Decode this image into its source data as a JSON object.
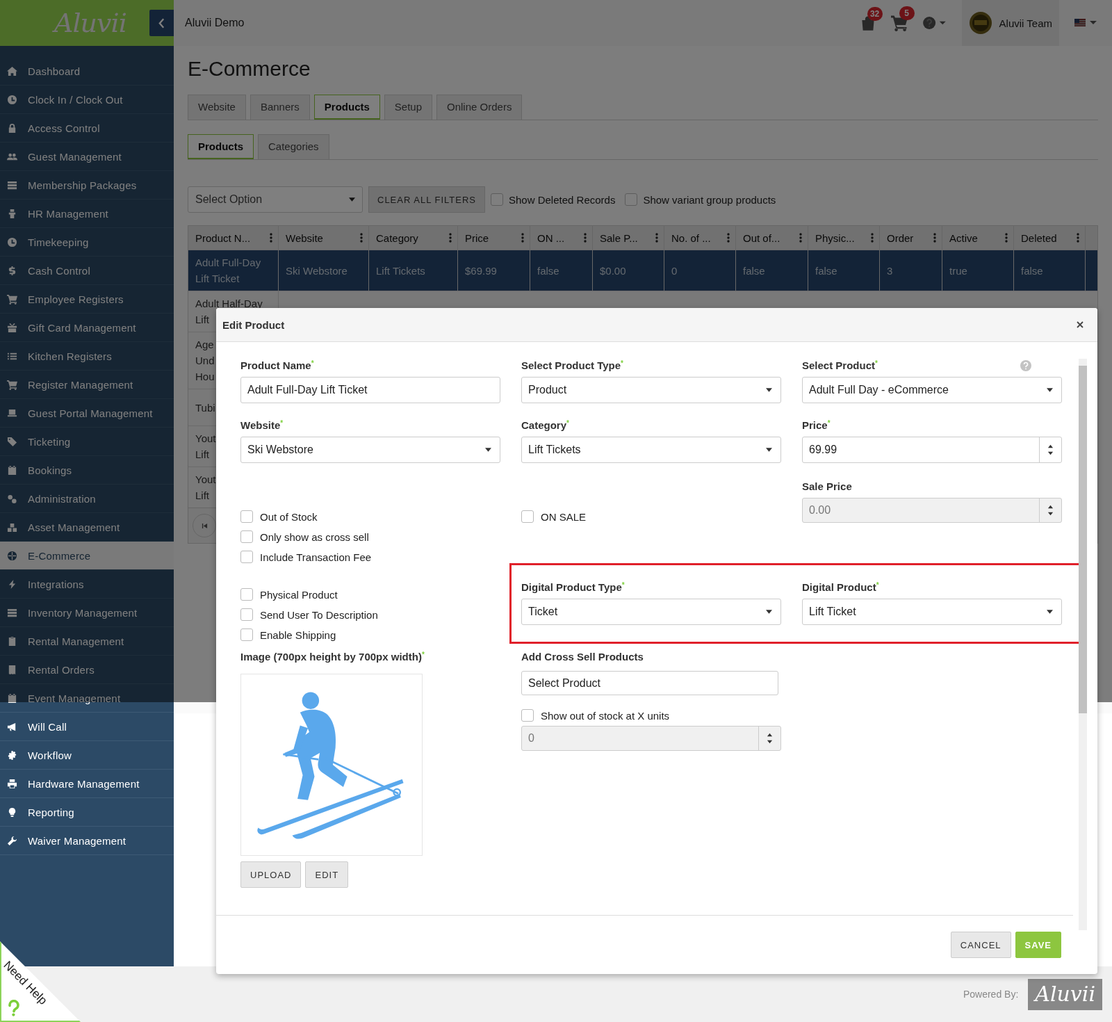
{
  "app": {
    "logo": "Aluvii",
    "title": "Aluvii Demo"
  },
  "header": {
    "notifications": [
      {
        "kind": "bag",
        "count": "32"
      },
      {
        "kind": "cart",
        "count": "5"
      }
    ],
    "user": "Aluvii Team"
  },
  "sidebar": {
    "items": [
      {
        "label": "Dashboard",
        "kind": "home",
        "selected": false
      },
      {
        "label": "Clock In / Clock Out",
        "kind": "clock",
        "selected": false
      },
      {
        "label": "Access Control",
        "kind": "lock",
        "selected": false
      },
      {
        "label": "Guest Management",
        "kind": "users",
        "selected": false
      },
      {
        "label": "Membership Packages",
        "kind": "stack",
        "selected": false
      },
      {
        "label": "HR Management",
        "kind": "person",
        "selected": false
      },
      {
        "label": "Timekeeping",
        "kind": "clock",
        "selected": false
      },
      {
        "label": "Cash Control",
        "kind": "dollar",
        "selected": false
      },
      {
        "label": "Employee Registers",
        "kind": "cart",
        "selected": false
      },
      {
        "label": "Gift Card Management",
        "kind": "gift",
        "selected": false
      },
      {
        "label": "Kitchen Registers",
        "kind": "list",
        "selected": false
      },
      {
        "label": "Register Management",
        "kind": "cart",
        "selected": false
      },
      {
        "label": "Guest Portal Management",
        "kind": "laptop",
        "selected": false
      },
      {
        "label": "Ticketing",
        "kind": "tag",
        "selected": false
      },
      {
        "label": "Bookings",
        "kind": "calendar",
        "selected": false
      },
      {
        "label": "Administration",
        "kind": "gears",
        "selected": false
      },
      {
        "label": "Asset Management",
        "kind": "boxes",
        "selected": false
      },
      {
        "label": "E-Commerce",
        "kind": "globe",
        "selected": true
      },
      {
        "label": "Integrations",
        "kind": "bolt",
        "selected": false
      },
      {
        "label": "Inventory Management",
        "kind": "stack",
        "selected": false
      },
      {
        "label": "Rental Management",
        "kind": "clipboard",
        "selected": false
      },
      {
        "label": "Rental Orders",
        "kind": "receipt",
        "selected": false
      },
      {
        "label": "Event Management",
        "kind": "calendar",
        "selected": false
      },
      {
        "label": "Will Call",
        "kind": "megaphone",
        "selected": false
      },
      {
        "label": "Workflow",
        "kind": "gear",
        "selected": false
      },
      {
        "label": "Hardware Management",
        "kind": "printer",
        "selected": false
      },
      {
        "label": "Reporting",
        "kind": "bulb",
        "selected": false
      },
      {
        "label": "Waiver Management",
        "kind": "wrench",
        "selected": false
      }
    ]
  },
  "page": {
    "title": "E-Commerce",
    "tabs": [
      {
        "label": "Website",
        "selected": false
      },
      {
        "label": "Banners",
        "selected": false
      },
      {
        "label": "Products",
        "selected": true
      },
      {
        "label": "Setup",
        "selected": false
      },
      {
        "label": "Online Orders",
        "selected": false
      }
    ],
    "subtabs": [
      {
        "label": "Products",
        "selected": true
      },
      {
        "label": "Categories",
        "selected": false
      }
    ],
    "filter_select": "Select Option",
    "clear_button": "CLEAR ALL FILTERS",
    "filters": [
      {
        "label": "Show Deleted Records",
        "checked": false
      },
      {
        "label": "Show variant group products",
        "checked": false
      }
    ],
    "table": {
      "columns": [
        "Product N...",
        "Website",
        "Category",
        "Price",
        "ON ...",
        "Sale P...",
        "No. of ...",
        "Out of...",
        "Physic...",
        "Order",
        "Active",
        "Deleted"
      ],
      "rows": [
        {
          "selected": true,
          "cells": [
            "Adult Full-Day\nLift Ticket",
            "Ski Webstore",
            "Lift Tickets",
            "$69.99",
            "false",
            "$0.00",
            "0",
            "false",
            "false",
            "3",
            "true",
            "false"
          ]
        },
        {
          "selected": false,
          "cells": [
            "Adult Half-Day\nLift"
          ]
        },
        {
          "selected": false,
          "cells": [
            "Age\nUnd\nHou"
          ]
        },
        {
          "selected": false,
          "cells": [
            "Tubi"
          ]
        },
        {
          "selected": false,
          "cells": [
            "Yout\nLift"
          ]
        },
        {
          "selected": false,
          "cells": [
            "Yout\nLift"
          ]
        }
      ]
    }
  },
  "modal": {
    "title": "Edit Product",
    "row1": [
      {
        "kind": "text",
        "label": "Product Name$^{*}$",
        "value": "Adult Full-Day Lift Ticket"
      },
      {
        "kind": "select",
        "label": "Select Product Type$^{*}$",
        "value": "Product"
      },
      {
        "kind": "select",
        "label": "Select Product$^{*}$",
        "value": "Adult Full Day - eCommerce",
        "help": true
      }
    ],
    "row2": [
      {
        "kind": "select",
        "label": "Website$^{*}$",
        "value": "Ski Webstore"
      },
      {
        "kind": "select",
        "label": "Category$^{*}$",
        "value": "Lift Tickets"
      },
      {
        "kind": "number",
        "label": "Price$^{*}$",
        "value": "69.99",
        "disabled": false
      }
    ],
    "sale_price": {
      "kind": "number",
      "label": "Sale Price",
      "value": "0.00",
      "disabled": true
    },
    "options_a": [
      {
        "label": "Out of Stock",
        "checked": false
      },
      {
        "label": "Only show as cross sell",
        "checked": false
      },
      {
        "label": "Include Transaction Fee",
        "checked": false
      }
    ],
    "on_sale": {
      "label": "ON SALE",
      "checked": false
    },
    "options_b": [
      {
        "label": "Physical Product",
        "checked": false
      },
      {
        "label": "Send User To Description",
        "checked": false
      },
      {
        "label": "Enable Shipping",
        "checked": false
      }
    ],
    "digital": {
      "highlighted": true,
      "fields": [
        {
          "kind": "select",
          "label": "Digital Product Type$^{*}$",
          "value": "Ticket"
        },
        {
          "kind": "select",
          "label": "Digital Product$^{*}$",
          "value": "Lift Ticket"
        }
      ]
    },
    "image": {
      "label": "Image (700px height by 700px width)$^{*}$",
      "buttons": [
        "UPLOAD",
        "EDIT"
      ]
    },
    "cross_sell": {
      "label": "Add Cross Sell Products",
      "placeholder": "Select Product"
    },
    "stock": {
      "label": "Show out of stock at X units",
      "checked": false,
      "value": "0",
      "disabled": true
    },
    "actions": [
      {
        "label": "CANCEL",
        "kind": "default"
      },
      {
        "label": "SAVE",
        "kind": "primary"
      }
    ]
  },
  "footer": {
    "powered": "Powered By:",
    "logo": "Aluvii",
    "help": "Need Help"
  }
}
